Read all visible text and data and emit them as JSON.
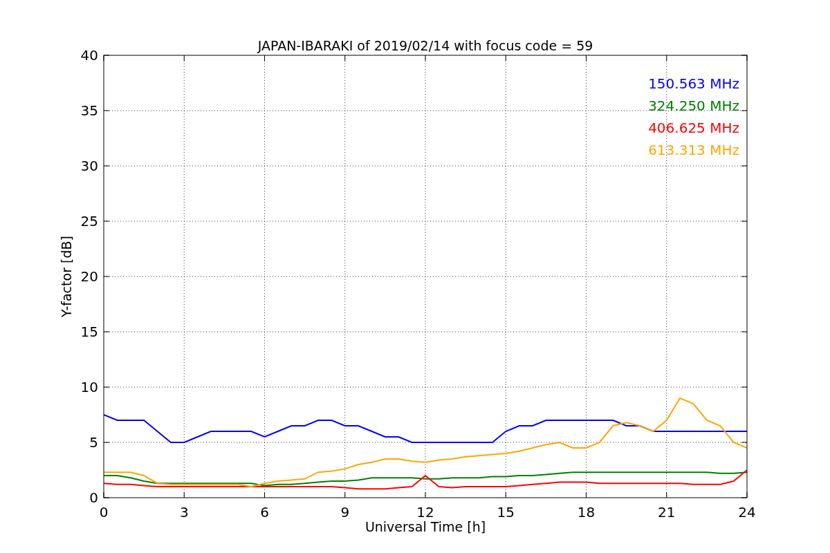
{
  "figure": {
    "chart_data": {
      "type": "line",
      "title": "JAPAN-IBARAKI of 2019/02/14 with focus code = 59",
      "xlabel": "Universal Time [h]",
      "ylabel": "Y-factor [dB]",
      "x": [
        0,
        0.5,
        1,
        1.5,
        2,
        2.5,
        3,
        3.5,
        4,
        4.5,
        5,
        5.5,
        6,
        6.5,
        7,
        7.5,
        8,
        8.5,
        9,
        9.5,
        10,
        10.5,
        11,
        11.5,
        12,
        12.5,
        13,
        13.5,
        14,
        14.5,
        15,
        15.5,
        16,
        16.5,
        17,
        17.5,
        18,
        18.5,
        19,
        19.5,
        20,
        20.5,
        21,
        21.5,
        22,
        22.5,
        23,
        23.5,
        24
      ],
      "series": [
        {
          "name": "150.563 MHz",
          "color": "#0000ff",
          "values": [
            7.5,
            7,
            7,
            7,
            6,
            5,
            5,
            5.5,
            6,
            6,
            6,
            6,
            5.5,
            6,
            6.5,
            6.5,
            7,
            7,
            6.5,
            6.5,
            6,
            5.5,
            5.5,
            5,
            5,
            5,
            5,
            5,
            5,
            5,
            6,
            6.5,
            6.5,
            7,
            7,
            7,
            7,
            7,
            7,
            6.5,
            6.5,
            6,
            6,
            6,
            6,
            6,
            6,
            6,
            6
          ]
        },
        {
          "name": "324.250 MHz",
          "color": "#008000",
          "values": [
            2,
            2,
            1.8,
            1.5,
            1.3,
            1.3,
            1.3,
            1.3,
            1.3,
            1.3,
            1.3,
            1.3,
            1.1,
            1.2,
            1.2,
            1.3,
            1.4,
            1.5,
            1.5,
            1.6,
            1.8,
            1.8,
            1.8,
            1.8,
            1.7,
            1.7,
            1.8,
            1.8,
            1.8,
            1.9,
            1.9,
            2,
            2,
            2.1,
            2.2,
            2.3,
            2.3,
            2.3,
            2.3,
            2.3,
            2.3,
            2.3,
            2.3,
            2.3,
            2.3,
            2.3,
            2.2,
            2.2,
            2.3
          ]
        },
        {
          "name": "406.625 MHz",
          "color": "#ff0000",
          "values": [
            1.3,
            1.2,
            1.2,
            1.1,
            1,
            1,
            1,
            1,
            1,
            1,
            1,
            1,
            1,
            1,
            1,
            1,
            1,
            1,
            0.9,
            0.8,
            0.8,
            0.8,
            0.9,
            1,
            2,
            1,
            0.9,
            1,
            1,
            1,
            1,
            1.1,
            1.2,
            1.3,
            1.4,
            1.4,
            1.4,
            1.3,
            1.3,
            1.3,
            1.3,
            1.3,
            1.3,
            1.3,
            1.2,
            1.2,
            1.2,
            1.5,
            2.5
          ]
        },
        {
          "name": "613.313 MHz",
          "color": "#ffa500",
          "values": [
            2.3,
            2.3,
            2.3,
            2,
            1.3,
            1.2,
            1.2,
            1.2,
            1.2,
            1.2,
            1.2,
            1,
            1.3,
            1.5,
            1.6,
            1.7,
            2.3,
            2.4,
            2.6,
            3,
            3.2,
            3.5,
            3.5,
            3.3,
            3.2,
            3.4,
            3.5,
            3.7,
            3.8,
            3.9,
            4,
            4.2,
            4.5,
            4.8,
            5,
            4.5,
            4.5,
            5,
            6.5,
            6.8,
            6.5,
            6,
            7,
            9,
            8.5,
            7,
            6.5,
            5,
            4.5
          ]
        }
      ],
      "xlim": [
        0,
        24
      ],
      "ylim": [
        0,
        40
      ],
      "xticks": [
        0,
        3,
        6,
        9,
        12,
        15,
        18,
        21,
        24
      ],
      "yticks": [
        0,
        5,
        10,
        15,
        20,
        25,
        30,
        35,
        40
      ],
      "grid": true
    }
  }
}
